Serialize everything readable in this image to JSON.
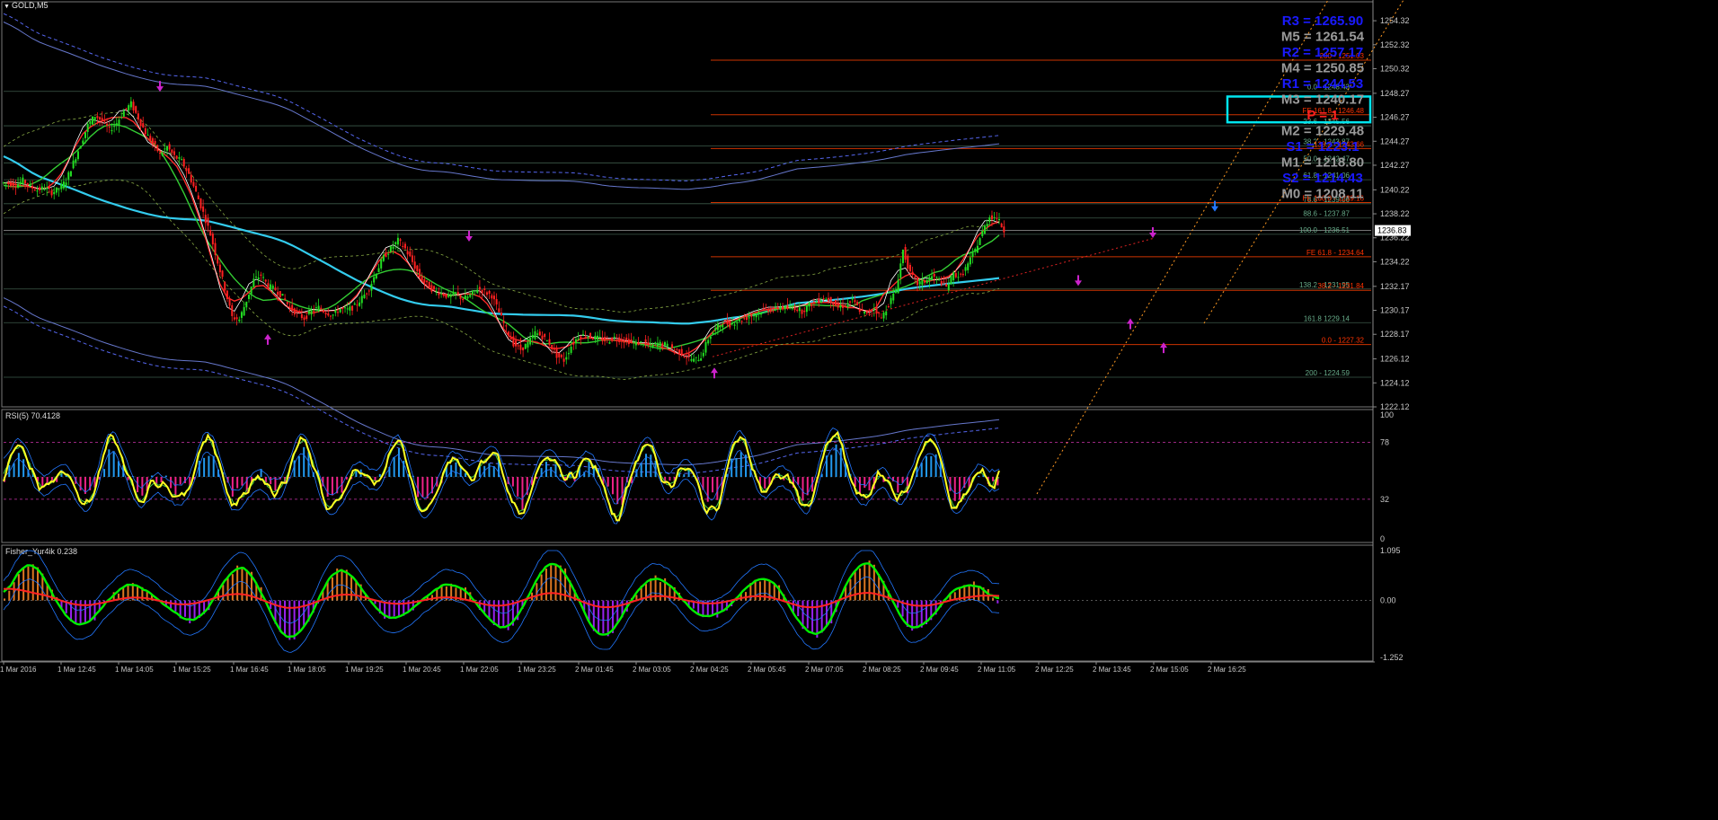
{
  "header": {
    "symbol_label": "GOLD,M5",
    "menu_glyph": "▼"
  },
  "colors": {
    "background": "#000000",
    "grid": "#3a3a3a",
    "axis": "#8a8a8a",
    "price_text": "#c8c8c8",
    "candle_up": "#22dd22",
    "candle_down": "#ff2020",
    "ma_fast": "#ffffff",
    "ma_red": "#ff2a2a",
    "ma_green": "#33cc33",
    "ma_cyan": "#33ccee",
    "env_blue": "#6677cc",
    "env_dash": "#5566ee",
    "fib_line": "#cc3300",
    "fib_text": "#66aa88",
    "fe_text": "#ff3300",
    "pivot_blue": "#1a1aff",
    "pivot_gray": "#9a9a9a",
    "pivot_red": "#ff2020",
    "box": "#00e5ee",
    "rsi_yellow": "#ffff22",
    "rsi_hist_up": "#2299ee",
    "rsi_hist_down": "#ee2288",
    "fisher_green": "#00ee00",
    "fisher_red": "#ff2222",
    "fisher_pos": "#dd7722",
    "fisher_neg": "#9922ee",
    "fisher_band": "#2277ff"
  },
  "price_axis": {
    "ticks": [
      "1254.32",
      "1252.32",
      "1250.32",
      "1248.27",
      "1246.27",
      "1244.27",
      "1242.27",
      "1240.22",
      "1238.22",
      "1236.22",
      "1234.22",
      "1232.17",
      "1230.17",
      "1228.17",
      "1226.12",
      "1224.12",
      "1222.12"
    ],
    "current_price": "1236.83"
  },
  "time_axis": {
    "labels": [
      "1 Mar 2016",
      "1 Mar 12:45",
      "1 Mar 14:05",
      "1 Mar 15:25",
      "1 Mar 16:45",
      "1 Mar 18:05",
      "1 Mar 19:25",
      "1 Mar 20:45",
      "1 Mar 22:05",
      "1 Mar 23:25",
      "2 Mar 01:45",
      "2 Mar 03:05",
      "2 Mar 04:25",
      "2 Mar 05:45",
      "2 Mar 07:05",
      "2 Mar 08:25",
      "2 Mar 09:45",
      "2 Mar 11:05",
      "2 Mar 12:25",
      "2 Mar 13:45",
      "2 Mar 15:05",
      "2 Mar 16:25"
    ]
  },
  "pivots": [
    {
      "label": "R3 = 1265.90",
      "color": "blue"
    },
    {
      "label": "M5 = 1261.54",
      "color": "gray"
    },
    {
      "label": "R2 = 1257.17",
      "color": "blue"
    },
    {
      "label": "M4 = 1250.85",
      "color": "gray"
    },
    {
      "label": "R1 = 1244.53",
      "color": "blue"
    },
    {
      "label": "M3 = 1240.17",
      "color": "gray"
    },
    {
      "label": "P  = 1",
      "color": "red"
    },
    {
      "label": "M2 = 1229.48",
      "color": "gray"
    },
    {
      "label": "S1 = 1223.1",
      "color": "blue"
    },
    {
      "label": "M1 = 1218.80",
      "color": "gray"
    },
    {
      "label": "S2 = 1214.43",
      "color": "blue"
    },
    {
      "label": "M0 = 1208.11",
      "color": "gray"
    }
  ],
  "fib_levels": [
    {
      "label": "200 - 1251.03",
      "style": "fe"
    },
    {
      "label": "0.0 - 1248.43",
      "style": "fib"
    },
    {
      "label": "FE 161.8 - 1246.48",
      "style": "fe"
    },
    {
      "label": "23.6 - 1245.56",
      "style": "fib"
    },
    {
      "label": "38.2 - 1243.87",
      "style": "fib"
    },
    {
      "label": "138.2 - 1243.66",
      "style": "fe"
    },
    {
      "label": "50.0 - 1242.47",
      "style": "fib"
    },
    {
      "label": "61.8 - 1241.06",
      "style": "fib"
    },
    {
      "label": "78.6 - 1239.06",
      "style": "fib"
    },
    {
      "label": "FE 100.0 - 1239.16",
      "style": "fe"
    },
    {
      "label": "88.6 - 1237.87",
      "style": "fib"
    },
    {
      "label": "100.0 - 1236.51",
      "style": "fib"
    },
    {
      "label": "FE 61.8 - 1234.64",
      "style": "fe"
    },
    {
      "label": "138.2 - 1231.95",
      "style": "fib"
    },
    {
      "label": "38.2 - 1231.84",
      "style": "fe"
    },
    {
      "label": "161.8 1229.14",
      "style": "fib"
    },
    {
      "label": "0.0 - 1227.32",
      "style": "fe"
    },
    {
      "label": "200 - 1224.59",
      "style": "fib"
    }
  ],
  "rsi": {
    "title": "RSI(5) 70.4128",
    "ticks": [
      "100",
      "78",
      "32",
      "0"
    ]
  },
  "fisher": {
    "title": "Fisher_Yur4ik 0.238",
    "ticks": [
      "1.095",
      "0.00",
      "-1.252"
    ]
  },
  "chart_data": {
    "type": "candlestick",
    "symbol": "GOLD",
    "timeframe": "M5",
    "ylim": [
      1222.12,
      1255.3
    ],
    "x_range": [
      "1 Mar 2016",
      "2 Mar 16:25"
    ],
    "last_price": 1236.83,
    "close_path": [
      1240.8,
      1240.6,
      1241.0,
      1240.5,
      1240.2,
      1240.4,
      1240.0,
      1240.3,
      1241.0,
      1242.5,
      1244.0,
      1245.6,
      1246.4,
      1246.0,
      1245.2,
      1245.8,
      1246.8,
      1247.4,
      1246.2,
      1245.0,
      1244.1,
      1243.2,
      1243.8,
      1243.0,
      1242.6,
      1241.5,
      1240.0,
      1238.3,
      1236.5,
      1234.2,
      1232.0,
      1229.6,
      1229.4,
      1231.0,
      1232.7,
      1233.1,
      1232.2,
      1231.9,
      1231.3,
      1230.4,
      1229.9,
      1229.5,
      1230.1,
      1230.4,
      1230.0,
      1229.8,
      1230.3,
      1230.2,
      1230.5,
      1231.2,
      1232.0,
      1233.4,
      1234.6,
      1235.3,
      1236.0,
      1235.3,
      1234.2,
      1233.0,
      1232.3,
      1231.8,
      1231.6,
      1231.3,
      1231.6,
      1231.1,
      1231.4,
      1232.0,
      1231.7,
      1231.4,
      1230.0,
      1228.6,
      1227.4,
      1226.9,
      1227.4,
      1228.3,
      1228.0,
      1227.4,
      1226.4,
      1226.0,
      1227.2,
      1228.0,
      1228.1,
      1227.9,
      1227.8,
      1227.6,
      1227.9,
      1227.7,
      1227.6,
      1227.4,
      1227.5,
      1227.2,
      1227.4,
      1227.3,
      1227.0,
      1226.7,
      1226.3,
      1226.0,
      1226.3,
      1227.8,
      1228.6,
      1229.2,
      1229.0,
      1229.3,
      1229.5,
      1229.7,
      1230.0,
      1230.3,
      1230.2,
      1230.5,
      1230.3,
      1230.4,
      1230.1,
      1230.6,
      1230.9,
      1231.2,
      1231.0,
      1230.4,
      1230.6,
      1231.0,
      1230.2,
      1229.8,
      1230.4,
      1229.5,
      1230.7,
      1231.8,
      1235.2,
      1233.2,
      1232.4,
      1232.6,
      1233.0,
      1232.7,
      1232.1,
      1233.2,
      1233.0,
      1234.0,
      1235.2,
      1236.7,
      1238.0,
      1237.9,
      1236.83
    ],
    "pivot_levels": {
      "R3": 1265.9,
      "M5": 1261.54,
      "R2": 1257.17,
      "M4": 1250.85,
      "R1": 1244.53,
      "M3": 1240.17,
      "M2": 1229.48,
      "M1": 1218.8,
      "S2": 1214.43,
      "M0": 1208.11
    },
    "fibonacci": [
      {
        "level": "0.0",
        "price": 1248.43
      },
      {
        "level": "23.6",
        "price": 1245.56
      },
      {
        "level": "38.2",
        "price": 1243.87
      },
      {
        "level": "50.0",
        "price": 1242.47
      },
      {
        "level": "61.8",
        "price": 1241.06
      },
      {
        "level": "78.6",
        "price": 1239.06
      },
      {
        "level": "88.6",
        "price": 1237.87
      },
      {
        "level": "100.0",
        "price": 1236.51
      },
      {
        "level": "138.2",
        "price": 1231.95
      },
      {
        "level": "161.8",
        "price": 1229.14
      },
      {
        "level": "200",
        "price": 1224.59
      }
    ],
    "fibonacci_expansion": [
      {
        "level": "200",
        "price": 1251.03
      },
      {
        "level": "FE 161.8",
        "price": 1246.48
      },
      {
        "level": "138.2",
        "price": 1243.66
      },
      {
        "level": "FE 100.0",
        "price": 1239.16
      },
      {
        "level": "FE 61.8",
        "price": 1234.64
      },
      {
        "level": "38.2",
        "price": 1231.84
      },
      {
        "level": "0.0",
        "price": 1227.32
      }
    ],
    "resistance_zone": {
      "y_top": 1248.0,
      "y_bottom": 1246.0,
      "x_start_fraction_of_series": 1.02
    },
    "rsi": {
      "period": 5,
      "value": 70.4128,
      "ylim": [
        0,
        100
      ],
      "levels": [
        78,
        32
      ]
    },
    "fisher": {
      "name": "Fisher_Yur4ik",
      "value": 0.238,
      "ylim": [
        -1.252,
        1.095
      ]
    }
  }
}
